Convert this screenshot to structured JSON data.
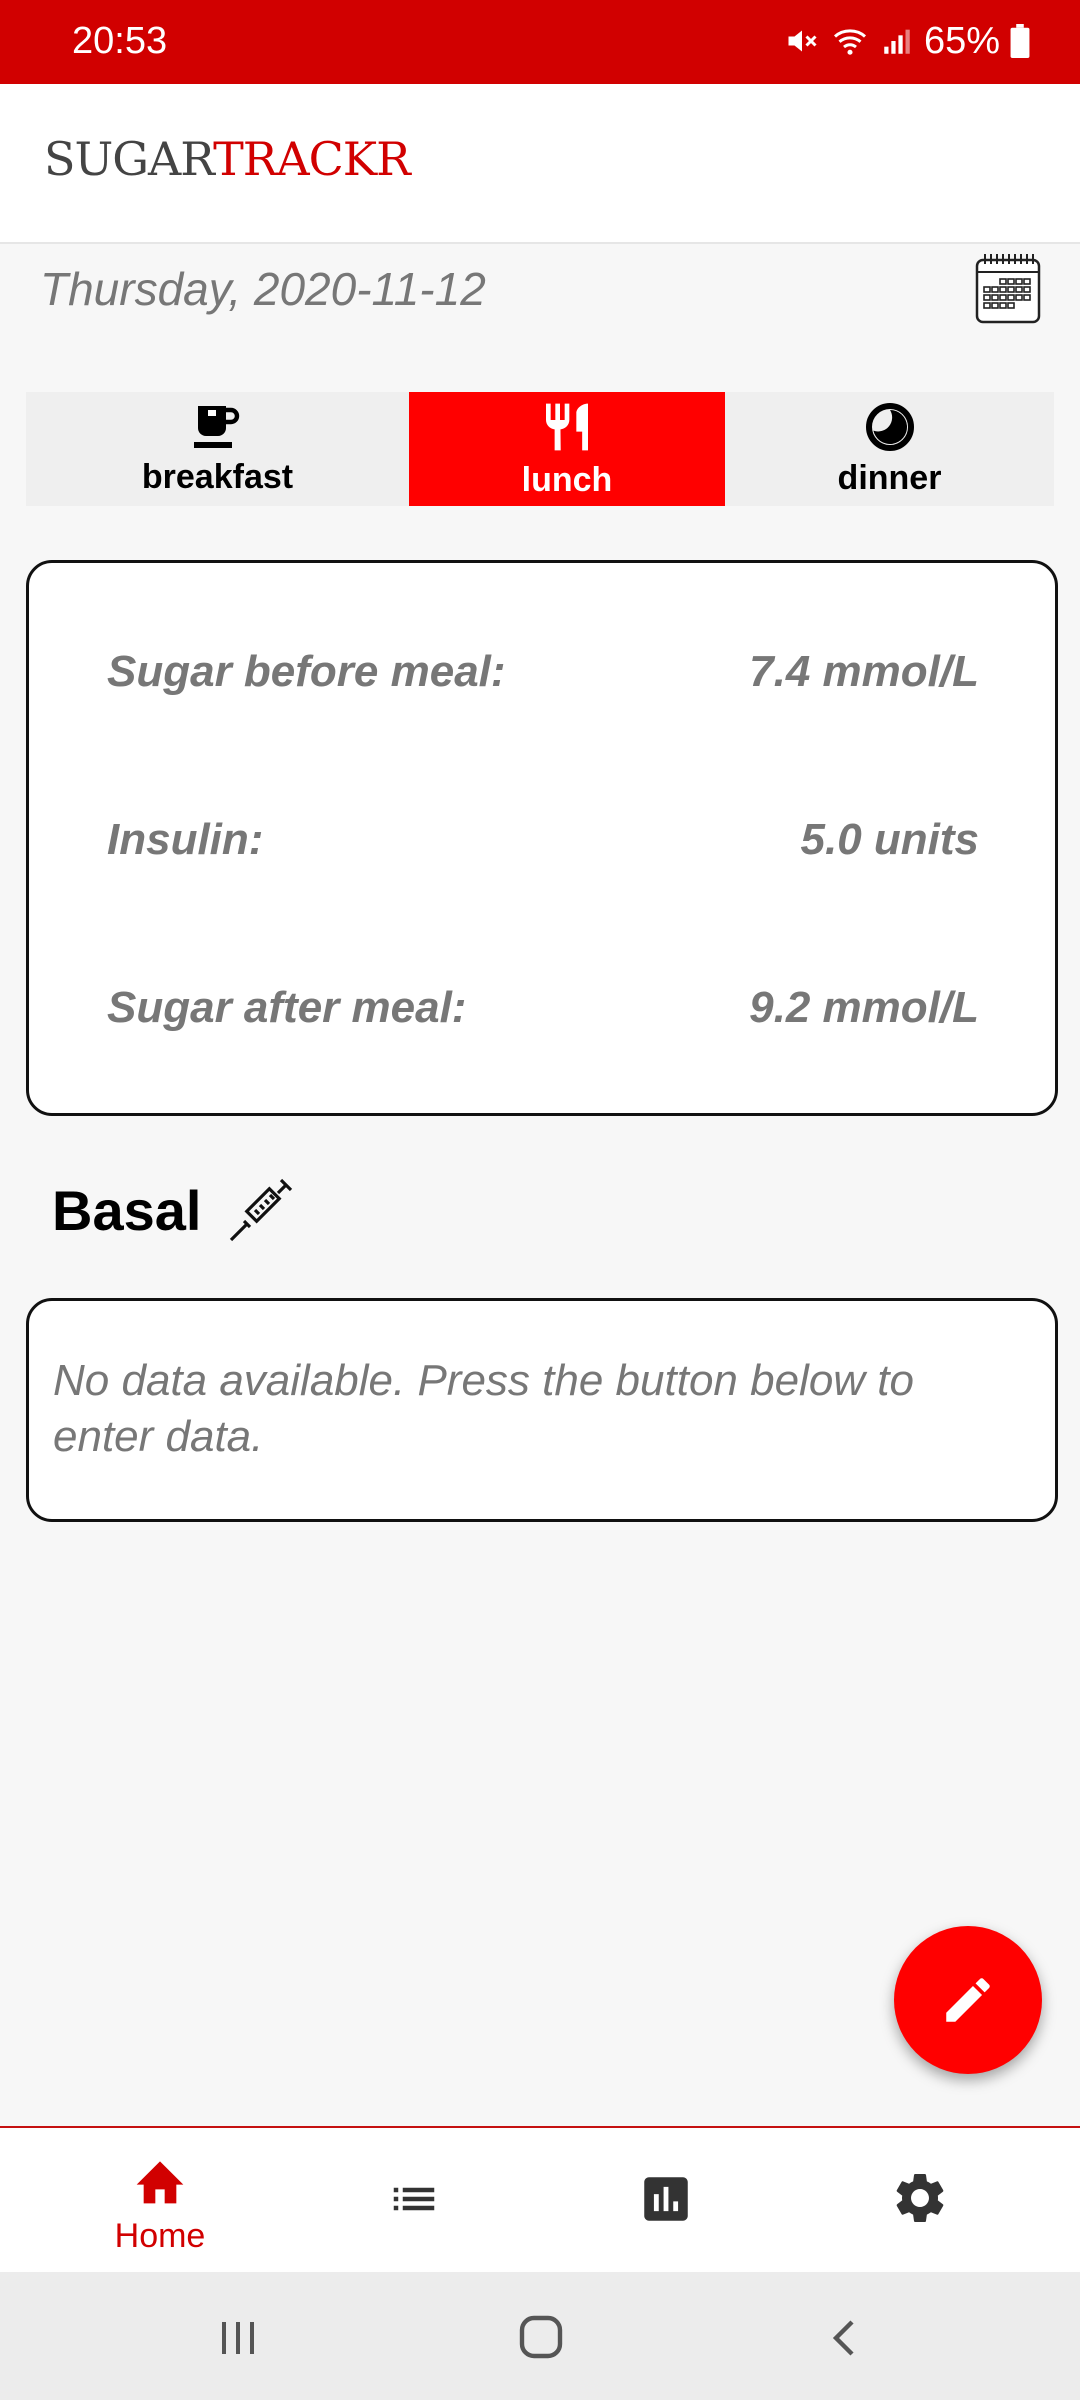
{
  "status_bar": {
    "time": "20:53",
    "battery": "65%"
  },
  "app": {
    "logo_part1": "SUGAR",
    "logo_part2": "TRACKR"
  },
  "date": "Thursday, 2020-11-12",
  "tabs": [
    {
      "label": "breakfast",
      "icon": "coffee-cup-icon",
      "active": false
    },
    {
      "label": "lunch",
      "icon": "fork-knife-icon",
      "active": true
    },
    {
      "label": "dinner",
      "icon": "moon-icon",
      "active": false
    }
  ],
  "meal": {
    "rows": [
      {
        "label": "Sugar before meal:",
        "value": "7.4 mmol/L"
      },
      {
        "label": "Insulin:",
        "value": "5.0 units"
      },
      {
        "label": "Sugar after meal:",
        "value": "9.2 mmol/L"
      }
    ]
  },
  "basal": {
    "title": "Basal",
    "empty_text": "No data available. Press the button below to enter data."
  },
  "bottom_nav": [
    {
      "label": "Home",
      "icon": "home-icon",
      "active": true
    },
    {
      "label": "",
      "icon": "list-icon",
      "active": false
    },
    {
      "label": "",
      "icon": "chart-icon",
      "active": false
    },
    {
      "label": "",
      "icon": "gear-icon",
      "active": false
    }
  ],
  "colors": {
    "accent": "#ff0000",
    "status_bar": "#d10000"
  }
}
